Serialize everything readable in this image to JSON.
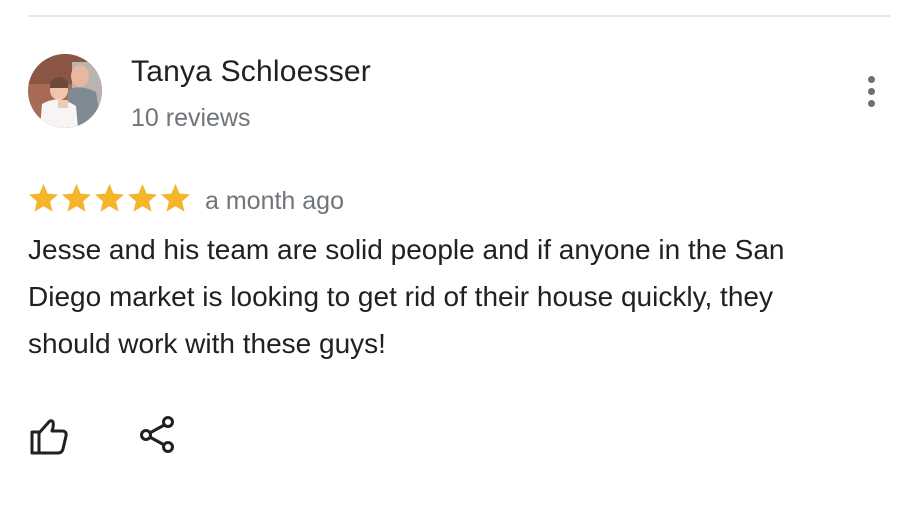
{
  "review": {
    "reviewer_name": "Tanya Schloesser",
    "review_count": "10 reviews",
    "rating": 5,
    "max_rating": 5,
    "date": "a month ago",
    "text": "Jesse and his team are solid people and if anyone in the San Diego market is looking to get rid of their house quickly, they should work with these guys!"
  },
  "icons": {
    "more": "more-vert-icon",
    "like": "thumbs-up-icon",
    "share": "share-icon",
    "star": "star-icon"
  },
  "colors": {
    "star": "#f4b52b",
    "text_primary": "#202124",
    "text_secondary": "#70757a",
    "divider": "#e6e6e6",
    "icon": "#3c4043"
  }
}
